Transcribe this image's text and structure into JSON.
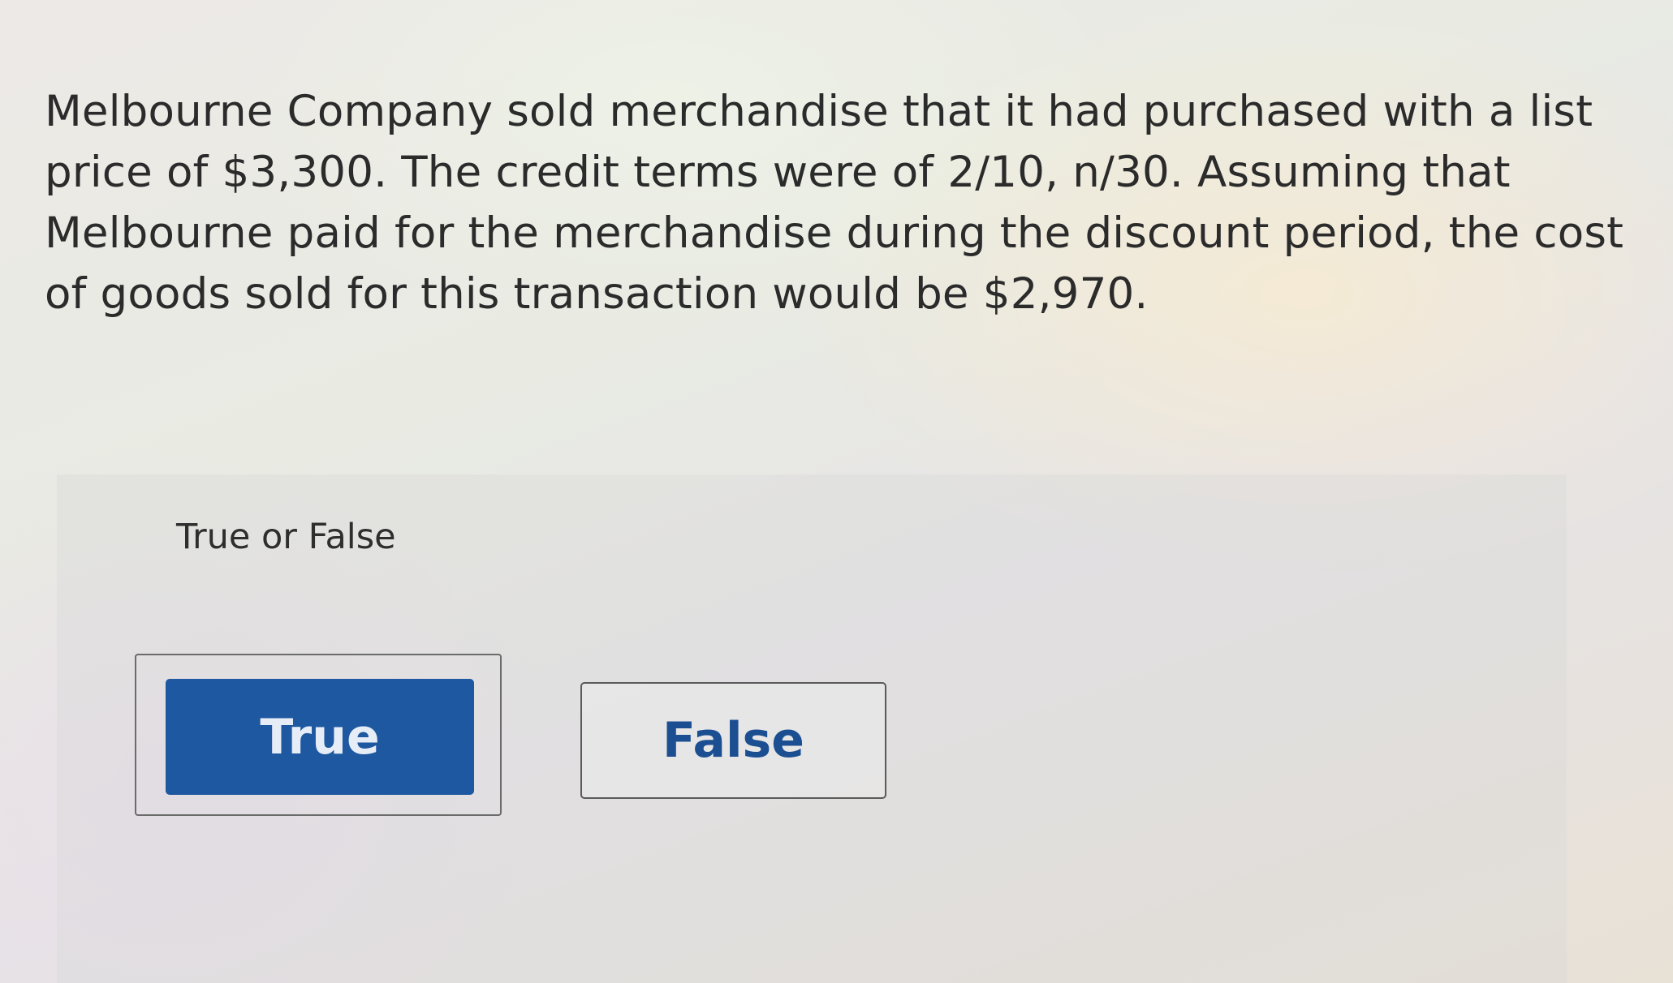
{
  "question": {
    "text": "Melbourne Company sold merchandise that it had purchased with a list price of $3,300. The credit terms were of 2/10, n/30. Assuming that Melbourne paid for the merchandise during the discount period, the cost of goods sold for this transaction would be $2,970."
  },
  "answer": {
    "prompt": "True or False",
    "true_label": "True",
    "false_label": "False",
    "selected": "True"
  },
  "colors": {
    "selected_button": "#1d58a0",
    "button_text_blue": "#1c4f91",
    "body_text": "#2b2b2b"
  }
}
